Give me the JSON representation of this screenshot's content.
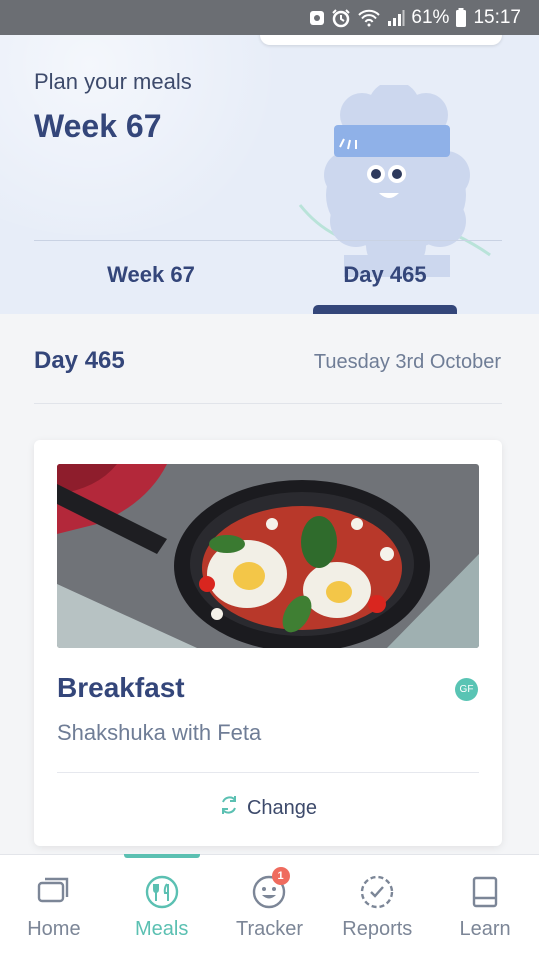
{
  "status_bar": {
    "battery": "61%",
    "time": "15:17",
    "icons": [
      "notification-icon",
      "alarm-icon",
      "wifi-icon",
      "signal-icon",
      "battery-icon"
    ]
  },
  "header": {
    "subtitle": "Plan your meals",
    "title": "Week 67",
    "tabs": [
      {
        "label": "Week 67",
        "active": false
      },
      {
        "label": "Day 465",
        "active": true
      }
    ]
  },
  "day": {
    "title": "Day 465",
    "date": "Tuesday 3rd October"
  },
  "meal": {
    "type": "Breakfast",
    "name": "Shakshuka with Feta",
    "badge": "GF",
    "change_label": "Change"
  },
  "bottom_nav": {
    "items": [
      {
        "label": "Home",
        "icon": "home-icon"
      },
      {
        "label": "Meals",
        "icon": "meals-icon",
        "active": true
      },
      {
        "label": "Tracker",
        "icon": "tracker-icon",
        "badge": "1"
      },
      {
        "label": "Reports",
        "icon": "reports-icon"
      },
      {
        "label": "Learn",
        "icon": "learn-icon"
      }
    ]
  },
  "colors": {
    "primary": "#34467a",
    "accent": "#5bc0b2",
    "header_bg": "#e7edf8",
    "badge": "#ef6b5e"
  }
}
